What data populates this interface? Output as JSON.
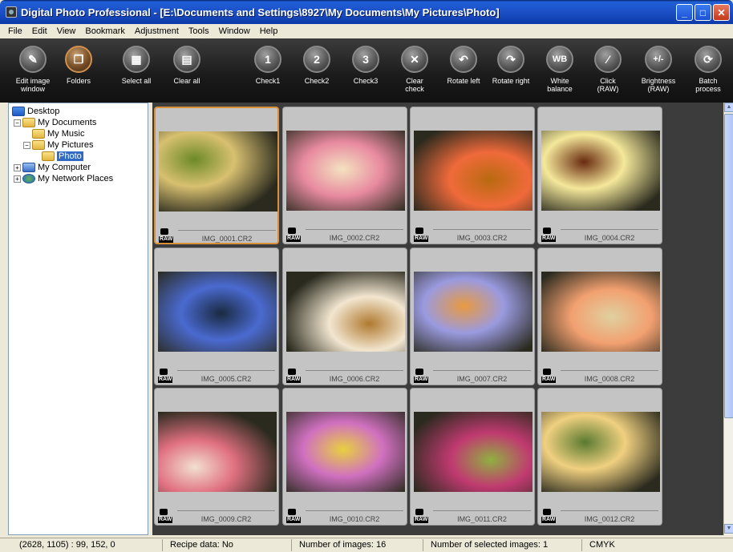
{
  "window": {
    "title": "Digital Photo Professional - [E:\\Documents and Settings\\8927\\My Documents\\My Pictures\\Photo]",
    "minimize_glyph": "_",
    "maximize_glyph": "□",
    "close_glyph": "✕"
  },
  "menu": {
    "items": [
      "File",
      "Edit",
      "View",
      "Bookmark",
      "Adjustment",
      "Tools",
      "Window",
      "Help"
    ]
  },
  "toolbar": {
    "buttons": [
      {
        "label": "Edit image\nwindow",
        "icon": "edit-image-window-icon"
      },
      {
        "label": "Folders",
        "icon": "folders-icon"
      },
      {
        "label": "Select all",
        "icon": "select-all-icon"
      },
      {
        "label": "Clear all",
        "icon": "clear-all-icon"
      },
      {
        "label": "Check1",
        "icon": "check1-icon"
      },
      {
        "label": "Check2",
        "icon": "check2-icon"
      },
      {
        "label": "Check3",
        "icon": "check3-icon"
      },
      {
        "label": "Clear\ncheck",
        "icon": "clear-check-icon"
      },
      {
        "label": "Rotate left",
        "icon": "rotate-left-icon"
      },
      {
        "label": "Rotate right",
        "icon": "rotate-right-icon"
      },
      {
        "label": "White\nbalance",
        "icon": "white-balance-icon"
      },
      {
        "label": "Click\n(RAW)",
        "icon": "eyedropper-icon"
      },
      {
        "label": "Brightness\n(RAW)",
        "icon": "brightness-icon"
      },
      {
        "label": "Batch\nprocess",
        "icon": "batch-process-icon"
      }
    ],
    "glyphs": [
      "✎",
      "❐",
      "▦",
      "▤",
      "1",
      "2",
      "3",
      "✕",
      "↶",
      "↷",
      "WB",
      "⁄",
      "+/-",
      "⟳"
    ]
  },
  "tree": {
    "expander_minus": "−",
    "expander_plus": "+",
    "items": [
      {
        "label": "Desktop",
        "icon": "desktop-icon"
      },
      {
        "label": "My Documents",
        "icon": "folder-icon"
      },
      {
        "label": "My Music",
        "icon": "folder-icon"
      },
      {
        "label": "My Pictures",
        "icon": "folder-icon"
      },
      {
        "label": "Photo",
        "icon": "folder-icon",
        "selected": true
      },
      {
        "label": "My Computer",
        "icon": "computer-icon"
      },
      {
        "label": "My Network Places",
        "icon": "network-icon"
      }
    ]
  },
  "thumbnails": [
    {
      "name": "IMG_0001.CR2",
      "badge": "RAW",
      "selected": true,
      "colors": [
        "#d8c070",
        "#6c8a28"
      ]
    },
    {
      "name": "IMG_0002.CR2",
      "badge": "RAW",
      "colors": [
        "#e88aa0",
        "#f4e2c0"
      ]
    },
    {
      "name": "IMG_0003.CR2",
      "badge": "RAW",
      "colors": [
        "#f06a3a",
        "#b86a10"
      ]
    },
    {
      "name": "IMG_0004.CR2",
      "badge": "RAW",
      "colors": [
        "#f4e89a",
        "#6a2a10"
      ]
    },
    {
      "name": "IMG_0005.CR2",
      "badge": "RAW",
      "colors": [
        "#4a6ad0",
        "#1a2a40"
      ]
    },
    {
      "name": "IMG_0006.CR2",
      "badge": "RAW",
      "colors": [
        "#f2e6d0",
        "#b07a30"
      ]
    },
    {
      "name": "IMG_0007.CR2",
      "badge": "RAW",
      "colors": [
        "#9a9ae0",
        "#e89a40"
      ]
    },
    {
      "name": "IMG_0008.CR2",
      "badge": "RAW",
      "colors": [
        "#f2a070",
        "#e0d0a0"
      ]
    },
    {
      "name": "IMG_0009.CR2",
      "badge": "RAW",
      "colors": [
        "#e07080",
        "#f2e0d0"
      ]
    },
    {
      "name": "IMG_0010.CR2",
      "badge": "RAW",
      "colors": [
        "#d070c0",
        "#e8d040"
      ]
    },
    {
      "name": "IMG_0011.CR2",
      "badge": "RAW",
      "colors": [
        "#c03a70",
        "#90b040"
      ]
    },
    {
      "name": "IMG_0012.CR2",
      "badge": "RAW",
      "colors": [
        "#f0d080",
        "#5a7a30"
      ]
    }
  ],
  "scrollbar": {
    "up": "▲",
    "down": "▼"
  },
  "status": {
    "coords": "(2628, 1105) :  99, 152,   0",
    "recipe": "Recipe data: No",
    "num_images": "Number of images: 16",
    "num_selected": "Number of selected images: 1",
    "color_mode": "CMYK"
  }
}
